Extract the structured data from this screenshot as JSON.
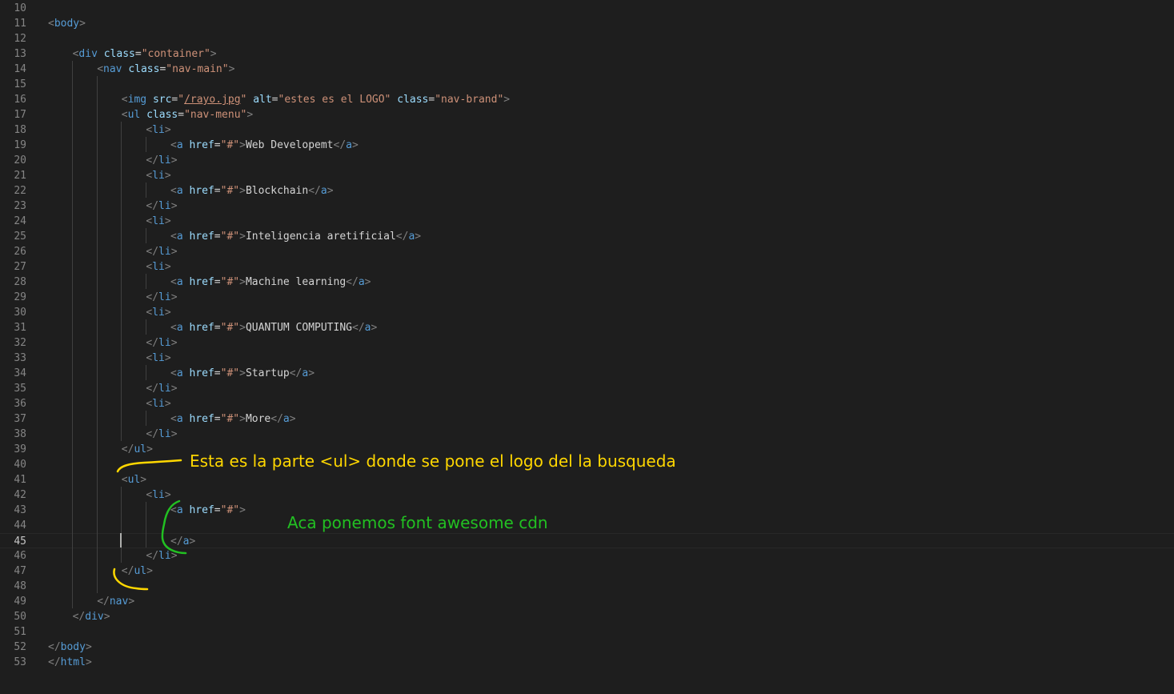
{
  "editor": {
    "current_line": "45",
    "lines": [
      {
        "no": "10",
        "indent": 0,
        "segs": []
      },
      {
        "no": "11",
        "indent": 0,
        "segs": [
          [
            "t",
            "<"
          ],
          [
            "tag",
            "body"
          ],
          [
            "t",
            ">"
          ]
        ]
      },
      {
        "no": "12",
        "indent": 0,
        "segs": []
      },
      {
        "no": "13",
        "indent": 1,
        "segs": [
          [
            "t",
            "<"
          ],
          [
            "tag",
            "div"
          ],
          [
            "txt",
            " "
          ],
          [
            "attr",
            "class"
          ],
          [
            "txt",
            "="
          ],
          [
            "str",
            "\"container\""
          ],
          [
            "t",
            ">"
          ]
        ]
      },
      {
        "no": "14",
        "indent": 2,
        "segs": [
          [
            "t",
            "<"
          ],
          [
            "tag",
            "nav"
          ],
          [
            "txt",
            " "
          ],
          [
            "attr",
            "class"
          ],
          [
            "txt",
            "="
          ],
          [
            "str",
            "\"nav-main\""
          ],
          [
            "t",
            ">"
          ]
        ]
      },
      {
        "no": "15",
        "indent": 0,
        "segs": []
      },
      {
        "no": "16",
        "indent": 3,
        "segs": [
          [
            "t",
            "<"
          ],
          [
            "tag",
            "img"
          ],
          [
            "txt",
            " "
          ],
          [
            "attr",
            "src"
          ],
          [
            "txt",
            "="
          ],
          [
            "str",
            "\""
          ],
          [
            "str link",
            "/rayo.jpg"
          ],
          [
            "str",
            "\""
          ],
          [
            "txt",
            " "
          ],
          [
            "attr",
            "alt"
          ],
          [
            "txt",
            "="
          ],
          [
            "str",
            "\"estes es el LOGO\""
          ],
          [
            "txt",
            " "
          ],
          [
            "attr",
            "class"
          ],
          [
            "txt",
            "="
          ],
          [
            "str",
            "\"nav-brand\""
          ],
          [
            "t",
            ">"
          ]
        ]
      },
      {
        "no": "17",
        "indent": 3,
        "segs": [
          [
            "t",
            "<"
          ],
          [
            "tag",
            "ul"
          ],
          [
            "txt",
            " "
          ],
          [
            "attr",
            "class"
          ],
          [
            "txt",
            "="
          ],
          [
            "str",
            "\"nav-menu\""
          ],
          [
            "t",
            ">"
          ]
        ]
      },
      {
        "no": "18",
        "indent": 4,
        "segs": [
          [
            "t",
            "<"
          ],
          [
            "tag",
            "li"
          ],
          [
            "t",
            ">"
          ]
        ]
      },
      {
        "no": "19",
        "indent": 5,
        "segs": [
          [
            "t",
            "<"
          ],
          [
            "tag",
            "a"
          ],
          [
            "txt",
            " "
          ],
          [
            "attr",
            "href"
          ],
          [
            "txt",
            "="
          ],
          [
            "str",
            "\"#\""
          ],
          [
            "t",
            ">"
          ],
          [
            "txt",
            "Web Developemt"
          ],
          [
            "t",
            "</"
          ],
          [
            "tag",
            "a"
          ],
          [
            "t",
            ">"
          ]
        ]
      },
      {
        "no": "20",
        "indent": 4,
        "segs": [
          [
            "t",
            "</"
          ],
          [
            "tag",
            "li"
          ],
          [
            "t",
            ">"
          ]
        ]
      },
      {
        "no": "21",
        "indent": 4,
        "segs": [
          [
            "t",
            "<"
          ],
          [
            "tag",
            "li"
          ],
          [
            "t",
            ">"
          ]
        ]
      },
      {
        "no": "22",
        "indent": 5,
        "segs": [
          [
            "t",
            "<"
          ],
          [
            "tag",
            "a"
          ],
          [
            "txt",
            " "
          ],
          [
            "attr",
            "href"
          ],
          [
            "txt",
            "="
          ],
          [
            "str",
            "\"#\""
          ],
          [
            "t",
            ">"
          ],
          [
            "txt",
            "Blockchain"
          ],
          [
            "t",
            "</"
          ],
          [
            "tag",
            "a"
          ],
          [
            "t",
            ">"
          ]
        ]
      },
      {
        "no": "23",
        "indent": 4,
        "segs": [
          [
            "t",
            "</"
          ],
          [
            "tag",
            "li"
          ],
          [
            "t",
            ">"
          ]
        ]
      },
      {
        "no": "24",
        "indent": 4,
        "segs": [
          [
            "t",
            "<"
          ],
          [
            "tag",
            "li"
          ],
          [
            "t",
            ">"
          ]
        ]
      },
      {
        "no": "25",
        "indent": 5,
        "segs": [
          [
            "t",
            "<"
          ],
          [
            "tag",
            "a"
          ],
          [
            "txt",
            " "
          ],
          [
            "attr",
            "href"
          ],
          [
            "txt",
            "="
          ],
          [
            "str",
            "\"#\""
          ],
          [
            "t",
            ">"
          ],
          [
            "txt",
            "Inteligencia aretificial"
          ],
          [
            "t",
            "</"
          ],
          [
            "tag",
            "a"
          ],
          [
            "t",
            ">"
          ]
        ]
      },
      {
        "no": "26",
        "indent": 4,
        "segs": [
          [
            "t",
            "</"
          ],
          [
            "tag",
            "li"
          ],
          [
            "t",
            ">"
          ]
        ]
      },
      {
        "no": "27",
        "indent": 4,
        "segs": [
          [
            "t",
            "<"
          ],
          [
            "tag",
            "li"
          ],
          [
            "t",
            ">"
          ]
        ]
      },
      {
        "no": "28",
        "indent": 5,
        "segs": [
          [
            "t",
            "<"
          ],
          [
            "tag",
            "a"
          ],
          [
            "txt",
            " "
          ],
          [
            "attr",
            "href"
          ],
          [
            "txt",
            "="
          ],
          [
            "str",
            "\"#\""
          ],
          [
            "t",
            ">"
          ],
          [
            "txt",
            "Machine learning"
          ],
          [
            "t",
            "</"
          ],
          [
            "tag",
            "a"
          ],
          [
            "t",
            ">"
          ]
        ]
      },
      {
        "no": "29",
        "indent": 4,
        "segs": [
          [
            "t",
            "</"
          ],
          [
            "tag",
            "li"
          ],
          [
            "t",
            ">"
          ]
        ]
      },
      {
        "no": "30",
        "indent": 4,
        "segs": [
          [
            "t",
            "<"
          ],
          [
            "tag",
            "li"
          ],
          [
            "t",
            ">"
          ]
        ]
      },
      {
        "no": "31",
        "indent": 5,
        "segs": [
          [
            "t",
            "<"
          ],
          [
            "tag",
            "a"
          ],
          [
            "txt",
            " "
          ],
          [
            "attr",
            "href"
          ],
          [
            "txt",
            "="
          ],
          [
            "str",
            "\"#\""
          ],
          [
            "t",
            ">"
          ],
          [
            "txt",
            "QUANTUM COMPUTING"
          ],
          [
            "t",
            "</"
          ],
          [
            "tag",
            "a"
          ],
          [
            "t",
            ">"
          ]
        ]
      },
      {
        "no": "32",
        "indent": 4,
        "segs": [
          [
            "t",
            "</"
          ],
          [
            "tag",
            "li"
          ],
          [
            "t",
            ">"
          ]
        ]
      },
      {
        "no": "33",
        "indent": 4,
        "segs": [
          [
            "t",
            "<"
          ],
          [
            "tag",
            "li"
          ],
          [
            "t",
            ">"
          ]
        ]
      },
      {
        "no": "34",
        "indent": 5,
        "segs": [
          [
            "t",
            "<"
          ],
          [
            "tag",
            "a"
          ],
          [
            "txt",
            " "
          ],
          [
            "attr",
            "href"
          ],
          [
            "txt",
            "="
          ],
          [
            "str",
            "\"#\""
          ],
          [
            "t",
            ">"
          ],
          [
            "txt",
            "Startup"
          ],
          [
            "t",
            "</"
          ],
          [
            "tag",
            "a"
          ],
          [
            "t",
            ">"
          ]
        ]
      },
      {
        "no": "35",
        "indent": 4,
        "segs": [
          [
            "t",
            "</"
          ],
          [
            "tag",
            "li"
          ],
          [
            "t",
            ">"
          ]
        ]
      },
      {
        "no": "36",
        "indent": 4,
        "segs": [
          [
            "t",
            "<"
          ],
          [
            "tag",
            "li"
          ],
          [
            "t",
            ">"
          ]
        ]
      },
      {
        "no": "37",
        "indent": 5,
        "segs": [
          [
            "t",
            "<"
          ],
          [
            "tag",
            "a"
          ],
          [
            "txt",
            " "
          ],
          [
            "attr",
            "href"
          ],
          [
            "txt",
            "="
          ],
          [
            "str",
            "\"#\""
          ],
          [
            "t",
            ">"
          ],
          [
            "txt",
            "More"
          ],
          [
            "t",
            "</"
          ],
          [
            "tag",
            "a"
          ],
          [
            "t",
            ">"
          ]
        ]
      },
      {
        "no": "38",
        "indent": 4,
        "segs": [
          [
            "t",
            "</"
          ],
          [
            "tag",
            "li"
          ],
          [
            "t",
            ">"
          ]
        ]
      },
      {
        "no": "39",
        "indent": 3,
        "segs": [
          [
            "t",
            "</"
          ],
          [
            "tag",
            "ul"
          ],
          [
            "t",
            ">"
          ]
        ]
      },
      {
        "no": "40",
        "indent": 0,
        "segs": []
      },
      {
        "no": "41",
        "indent": 3,
        "segs": [
          [
            "t",
            "<"
          ],
          [
            "tag",
            "ul"
          ],
          [
            "t",
            ">"
          ]
        ]
      },
      {
        "no": "42",
        "indent": 4,
        "segs": [
          [
            "t",
            "<"
          ],
          [
            "tag",
            "li"
          ],
          [
            "t",
            ">"
          ]
        ]
      },
      {
        "no": "43",
        "indent": 5,
        "segs": [
          [
            "t",
            "<"
          ],
          [
            "tag",
            "a"
          ],
          [
            "txt",
            " "
          ],
          [
            "attr",
            "href"
          ],
          [
            "txt",
            "="
          ],
          [
            "str",
            "\"#\""
          ],
          [
            "t",
            ">"
          ]
        ]
      },
      {
        "no": "44",
        "indent": 0,
        "segs": []
      },
      {
        "no": "45",
        "indent": 5,
        "segs": [
          [
            "t",
            "</"
          ],
          [
            "tag",
            "a"
          ],
          [
            "t",
            ">"
          ]
        ]
      },
      {
        "no": "46",
        "indent": 4,
        "segs": [
          [
            "t",
            "</"
          ],
          [
            "tag",
            "li"
          ],
          [
            "t",
            ">"
          ]
        ]
      },
      {
        "no": "47",
        "indent": 3,
        "segs": [
          [
            "t",
            "</"
          ],
          [
            "tag",
            "ul"
          ],
          [
            "t",
            ">"
          ]
        ]
      },
      {
        "no": "48",
        "indent": 0,
        "segs": []
      },
      {
        "no": "49",
        "indent": 2,
        "segs": [
          [
            "t",
            "</"
          ],
          [
            "tag",
            "nav"
          ],
          [
            "t",
            ">"
          ]
        ]
      },
      {
        "no": "50",
        "indent": 1,
        "segs": [
          [
            "t",
            "</"
          ],
          [
            "tag",
            "div"
          ],
          [
            "t",
            ">"
          ]
        ]
      },
      {
        "no": "51",
        "indent": 0,
        "segs": []
      },
      {
        "no": "52",
        "indent": 0,
        "segs": [
          [
            "t",
            "</"
          ],
          [
            "tag",
            "body"
          ],
          [
            "t",
            ">"
          ]
        ]
      },
      {
        "no": "53",
        "indent": 0,
        "segs": [
          [
            "t",
            "</"
          ],
          [
            "tag",
            "html"
          ],
          [
            "t",
            ">"
          ]
        ]
      }
    ]
  },
  "annotations": {
    "yellow_note": "Esta es la parte <ul> donde se pone el logo del la busqueda",
    "green_note": "Aca ponemos font awesome cdn",
    "yellow_color": "#ffd700",
    "green_color": "#22c022"
  },
  "theme": {
    "background": "#1e1e1e",
    "line_number": "#858585",
    "tag": "#569cd6",
    "attribute": "#9cdcfe",
    "string": "#ce9178",
    "bracket": "#808080",
    "text": "#d4d4d4"
  }
}
